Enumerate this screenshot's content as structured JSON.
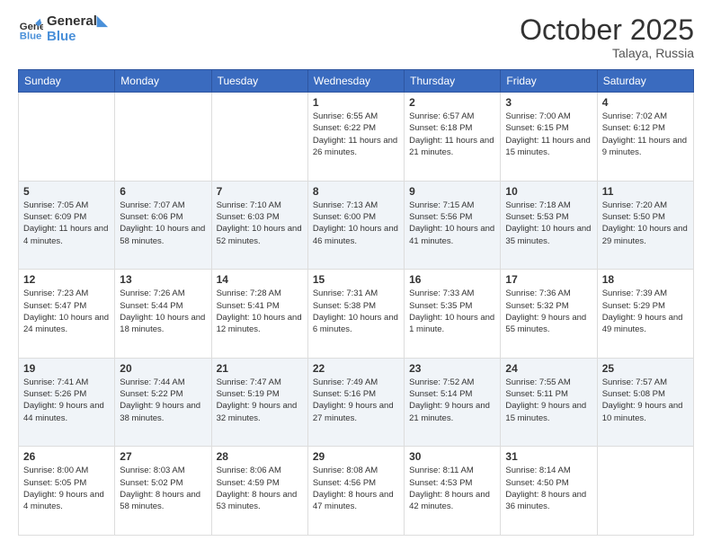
{
  "header": {
    "logo_line1": "General",
    "logo_line2": "Blue",
    "month": "October 2025",
    "location": "Talaya, Russia"
  },
  "weekdays": [
    "Sunday",
    "Monday",
    "Tuesday",
    "Wednesday",
    "Thursday",
    "Friday",
    "Saturday"
  ],
  "weeks": [
    [
      {
        "day": "",
        "sunrise": "",
        "sunset": "",
        "daylight": ""
      },
      {
        "day": "",
        "sunrise": "",
        "sunset": "",
        "daylight": ""
      },
      {
        "day": "",
        "sunrise": "",
        "sunset": "",
        "daylight": ""
      },
      {
        "day": "1",
        "sunrise": "Sunrise: 6:55 AM",
        "sunset": "Sunset: 6:22 PM",
        "daylight": "Daylight: 11 hours and 26 minutes."
      },
      {
        "day": "2",
        "sunrise": "Sunrise: 6:57 AM",
        "sunset": "Sunset: 6:18 PM",
        "daylight": "Daylight: 11 hours and 21 minutes."
      },
      {
        "day": "3",
        "sunrise": "Sunrise: 7:00 AM",
        "sunset": "Sunset: 6:15 PM",
        "daylight": "Daylight: 11 hours and 15 minutes."
      },
      {
        "day": "4",
        "sunrise": "Sunrise: 7:02 AM",
        "sunset": "Sunset: 6:12 PM",
        "daylight": "Daylight: 11 hours and 9 minutes."
      }
    ],
    [
      {
        "day": "5",
        "sunrise": "Sunrise: 7:05 AM",
        "sunset": "Sunset: 6:09 PM",
        "daylight": "Daylight: 11 hours and 4 minutes."
      },
      {
        "day": "6",
        "sunrise": "Sunrise: 7:07 AM",
        "sunset": "Sunset: 6:06 PM",
        "daylight": "Daylight: 10 hours and 58 minutes."
      },
      {
        "day": "7",
        "sunrise": "Sunrise: 7:10 AM",
        "sunset": "Sunset: 6:03 PM",
        "daylight": "Daylight: 10 hours and 52 minutes."
      },
      {
        "day": "8",
        "sunrise": "Sunrise: 7:13 AM",
        "sunset": "Sunset: 6:00 PM",
        "daylight": "Daylight: 10 hours and 46 minutes."
      },
      {
        "day": "9",
        "sunrise": "Sunrise: 7:15 AM",
        "sunset": "Sunset: 5:56 PM",
        "daylight": "Daylight: 10 hours and 41 minutes."
      },
      {
        "day": "10",
        "sunrise": "Sunrise: 7:18 AM",
        "sunset": "Sunset: 5:53 PM",
        "daylight": "Daylight: 10 hours and 35 minutes."
      },
      {
        "day": "11",
        "sunrise": "Sunrise: 7:20 AM",
        "sunset": "Sunset: 5:50 PM",
        "daylight": "Daylight: 10 hours and 29 minutes."
      }
    ],
    [
      {
        "day": "12",
        "sunrise": "Sunrise: 7:23 AM",
        "sunset": "Sunset: 5:47 PM",
        "daylight": "Daylight: 10 hours and 24 minutes."
      },
      {
        "day": "13",
        "sunrise": "Sunrise: 7:26 AM",
        "sunset": "Sunset: 5:44 PM",
        "daylight": "Daylight: 10 hours and 18 minutes."
      },
      {
        "day": "14",
        "sunrise": "Sunrise: 7:28 AM",
        "sunset": "Sunset: 5:41 PM",
        "daylight": "Daylight: 10 hours and 12 minutes."
      },
      {
        "day": "15",
        "sunrise": "Sunrise: 7:31 AM",
        "sunset": "Sunset: 5:38 PM",
        "daylight": "Daylight: 10 hours and 6 minutes."
      },
      {
        "day": "16",
        "sunrise": "Sunrise: 7:33 AM",
        "sunset": "Sunset: 5:35 PM",
        "daylight": "Daylight: 10 hours and 1 minute."
      },
      {
        "day": "17",
        "sunrise": "Sunrise: 7:36 AM",
        "sunset": "Sunset: 5:32 PM",
        "daylight": "Daylight: 9 hours and 55 minutes."
      },
      {
        "day": "18",
        "sunrise": "Sunrise: 7:39 AM",
        "sunset": "Sunset: 5:29 PM",
        "daylight": "Daylight: 9 hours and 49 minutes."
      }
    ],
    [
      {
        "day": "19",
        "sunrise": "Sunrise: 7:41 AM",
        "sunset": "Sunset: 5:26 PM",
        "daylight": "Daylight: 9 hours and 44 minutes."
      },
      {
        "day": "20",
        "sunrise": "Sunrise: 7:44 AM",
        "sunset": "Sunset: 5:22 PM",
        "daylight": "Daylight: 9 hours and 38 minutes."
      },
      {
        "day": "21",
        "sunrise": "Sunrise: 7:47 AM",
        "sunset": "Sunset: 5:19 PM",
        "daylight": "Daylight: 9 hours and 32 minutes."
      },
      {
        "day": "22",
        "sunrise": "Sunrise: 7:49 AM",
        "sunset": "Sunset: 5:16 PM",
        "daylight": "Daylight: 9 hours and 27 minutes."
      },
      {
        "day": "23",
        "sunrise": "Sunrise: 7:52 AM",
        "sunset": "Sunset: 5:14 PM",
        "daylight": "Daylight: 9 hours and 21 minutes."
      },
      {
        "day": "24",
        "sunrise": "Sunrise: 7:55 AM",
        "sunset": "Sunset: 5:11 PM",
        "daylight": "Daylight: 9 hours and 15 minutes."
      },
      {
        "day": "25",
        "sunrise": "Sunrise: 7:57 AM",
        "sunset": "Sunset: 5:08 PM",
        "daylight": "Daylight: 9 hours and 10 minutes."
      }
    ],
    [
      {
        "day": "26",
        "sunrise": "Sunrise: 8:00 AM",
        "sunset": "Sunset: 5:05 PM",
        "daylight": "Daylight: 9 hours and 4 minutes."
      },
      {
        "day": "27",
        "sunrise": "Sunrise: 8:03 AM",
        "sunset": "Sunset: 5:02 PM",
        "daylight": "Daylight: 8 hours and 58 minutes."
      },
      {
        "day": "28",
        "sunrise": "Sunrise: 8:06 AM",
        "sunset": "Sunset: 4:59 PM",
        "daylight": "Daylight: 8 hours and 53 minutes."
      },
      {
        "day": "29",
        "sunrise": "Sunrise: 8:08 AM",
        "sunset": "Sunset: 4:56 PM",
        "daylight": "Daylight: 8 hours and 47 minutes."
      },
      {
        "day": "30",
        "sunrise": "Sunrise: 8:11 AM",
        "sunset": "Sunset: 4:53 PM",
        "daylight": "Daylight: 8 hours and 42 minutes."
      },
      {
        "day": "31",
        "sunrise": "Sunrise: 8:14 AM",
        "sunset": "Sunset: 4:50 PM",
        "daylight": "Daylight: 8 hours and 36 minutes."
      },
      {
        "day": "",
        "sunrise": "",
        "sunset": "",
        "daylight": ""
      }
    ]
  ]
}
